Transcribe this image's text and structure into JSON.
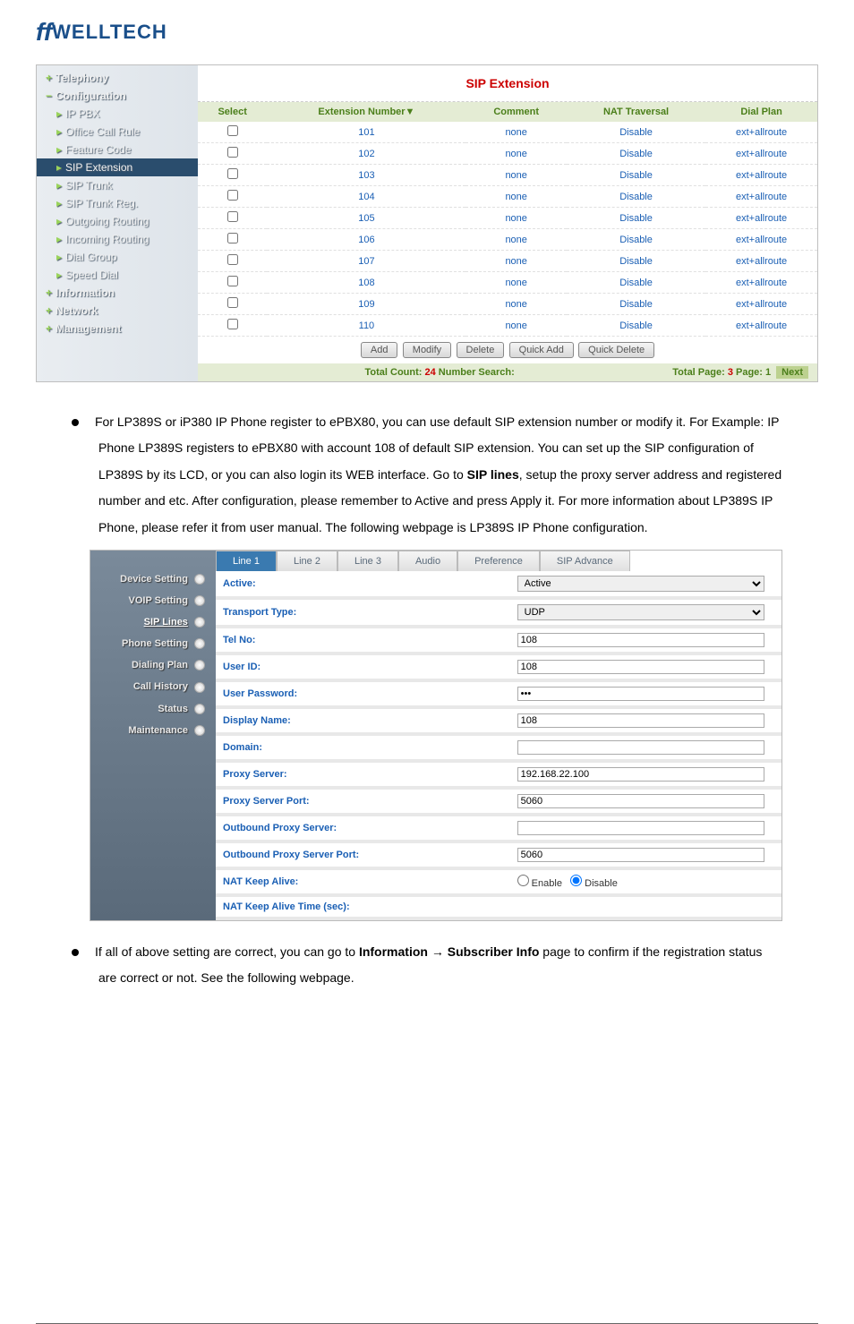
{
  "logo": {
    "symbol": "ff",
    "text": "WELLTECH"
  },
  "nav": {
    "top": [
      {
        "icon": "+",
        "label": "Telephony"
      },
      {
        "icon": "−",
        "label": "Configuration"
      }
    ],
    "sub": [
      {
        "label": "IP PBX"
      },
      {
        "label": "Office Call Rule"
      },
      {
        "label": "Feature Code"
      },
      {
        "label": "SIP Extension",
        "active": true
      },
      {
        "label": "SIP Trunk"
      },
      {
        "label": "SIP Trunk Reg."
      },
      {
        "label": "Outgoing Routing"
      },
      {
        "label": "Incoming Routing"
      },
      {
        "label": "Dial Group"
      },
      {
        "label": "Speed Dial"
      }
    ],
    "bottom": [
      {
        "icon": "+",
        "label": "Information"
      },
      {
        "icon": "+",
        "label": "Network"
      },
      {
        "icon": "+",
        "label": "Management"
      }
    ]
  },
  "panel": {
    "title": "SIP Extension",
    "headers": [
      "Select",
      "Extension Number▼",
      "Comment",
      "NAT Traversal",
      "Dial Plan"
    ],
    "rows": [
      {
        "ext": "101",
        "comment": "none",
        "nat": "Disable",
        "plan": "ext+allroute"
      },
      {
        "ext": "102",
        "comment": "none",
        "nat": "Disable",
        "plan": "ext+allroute"
      },
      {
        "ext": "103",
        "comment": "none",
        "nat": "Disable",
        "plan": "ext+allroute"
      },
      {
        "ext": "104",
        "comment": "none",
        "nat": "Disable",
        "plan": "ext+allroute"
      },
      {
        "ext": "105",
        "comment": "none",
        "nat": "Disable",
        "plan": "ext+allroute"
      },
      {
        "ext": "106",
        "comment": "none",
        "nat": "Disable",
        "plan": "ext+allroute"
      },
      {
        "ext": "107",
        "comment": "none",
        "nat": "Disable",
        "plan": "ext+allroute"
      },
      {
        "ext": "108",
        "comment": "none",
        "nat": "Disable",
        "plan": "ext+allroute"
      },
      {
        "ext": "109",
        "comment": "none",
        "nat": "Disable",
        "plan": "ext+allroute"
      },
      {
        "ext": "110",
        "comment": "none",
        "nat": "Disable",
        "plan": "ext+allroute"
      }
    ],
    "buttons": {
      "add": "Add",
      "modify": "Modify",
      "delete": "Delete",
      "quickadd": "Quick Add",
      "quickdel": "Quick Delete"
    },
    "footer": {
      "left_a": "Total Count: ",
      "left_b": "24",
      "left_c": "  Number Search:",
      "right_a": "Total Page: ",
      "right_b": "3",
      "right_c": "  Page: ",
      "right_d": "1",
      "next": "Next"
    }
  },
  "para1": "For LP389S or iP380 IP Phone register to ePBX80, you can use default SIP extension number or modify it. For Example: IP Phone LP389S registers to ePBX80 with account 108 of default SIP extension. You can set up the SIP configuration of LP389S by its LCD, or you can also login its WEB interface. Go to ",
  "para1_bold": "SIP lines",
  "para1_b": ", setup the proxy server address and registered number and etc. After configuration, please remember to Active and press Apply it. For more information about LP389S IP Phone, please refer it from user manual. The following webpage is LP389S IP Phone configuration.",
  "nav2": [
    "Device Setting",
    "VOIP Setting",
    "SIP Lines",
    "Phone Setting",
    "Dialing Plan",
    "Call History",
    "Status",
    "Maintenance"
  ],
  "tabs2": [
    "Line 1",
    "Line 2",
    "Line 3",
    "Audio",
    "Preference",
    "SIP Advance"
  ],
  "form": [
    {
      "label": "Active:",
      "type": "select",
      "value": "Active"
    },
    {
      "label": "Transport Type:",
      "type": "select",
      "value": "UDP"
    },
    {
      "label": "Tel No:",
      "type": "text",
      "value": "108"
    },
    {
      "label": "User ID:",
      "type": "text",
      "value": "108"
    },
    {
      "label": "User Password:",
      "type": "password",
      "value": "•••"
    },
    {
      "label": "Display Name:",
      "type": "text",
      "value": "108"
    },
    {
      "label": "Domain:",
      "type": "text",
      "value": ""
    },
    {
      "label": "Proxy Server:",
      "type": "text",
      "value": "192.168.22.100"
    },
    {
      "label": "Proxy Server Port:",
      "type": "text",
      "value": "5060"
    },
    {
      "label": "Outbound Proxy Server:",
      "type": "text",
      "value": ""
    },
    {
      "label": "Outbound Proxy Server Port:",
      "type": "text",
      "value": "5060"
    },
    {
      "label": "NAT Keep Alive:",
      "type": "radio",
      "opt1": "Enable",
      "opt2": "Disable"
    },
    {
      "label": "NAT Keep Alive Time (sec):",
      "type": "none"
    }
  ],
  "para2_a": "If all of above setting are correct, you can go to ",
  "para2_bold": "Information → Subscriber Info",
  "para2_b": " page to confirm if the registration status are correct or not. See the following webpage."
}
